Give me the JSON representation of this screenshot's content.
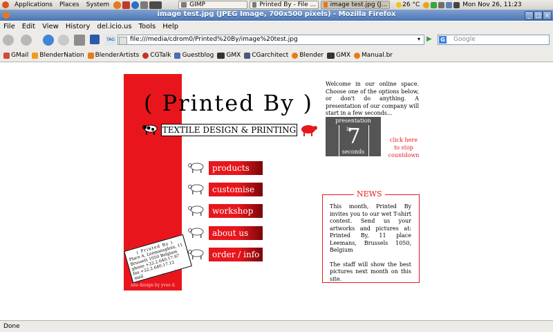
{
  "colors": {
    "accent_red": "#e8161c",
    "panel_bg": "#d7d3cc",
    "titlebar": "#4a75b5",
    "counter_bg": "#555555"
  },
  "panel": {
    "menus": [
      "Applications",
      "Places",
      "System"
    ],
    "tasks": [
      "GIMP",
      "Printed By - File ...",
      "image test.jpg (J..."
    ],
    "weather": "26 °C",
    "clock": "Mon Nov 26, 11:23"
  },
  "window": {
    "title": "image test.jpg (JPEG Image, 700x500 pixels) - Mozilla Firefox"
  },
  "menubar": [
    "File",
    "Edit",
    "View",
    "History",
    "del.icio.us",
    "Tools",
    "Help"
  ],
  "navbar": {
    "url": "file:///media/cdrom0/Printed%20By/image%20test.jpg",
    "search_placeholder": "Google"
  },
  "bookmarks": [
    "GMail",
    "BlenderNation",
    "BlenderArtists",
    "CGTalk",
    "Guestblog",
    "GMX",
    "CGarchitect",
    "Blender",
    "GMX",
    "Manual.br"
  ],
  "page": {
    "brand": "( Printed By )",
    "tagline": "TEXTILE DESIGN & PRINTING",
    "nav": [
      "products",
      "customise",
      "workshop",
      "about us",
      "order / info"
    ],
    "welcome": "Welcome in our online space. Choose one of the options below, or don't do anything. A presentation of our company will start in a few seconds...",
    "counter": {
      "label_top": "presentation",
      "label_in": "in",
      "number": "7",
      "label_bottom": "seconds"
    },
    "click_here": "click here to stop countdown",
    "news": {
      "title": "NEWS",
      "p1": "This month, Printed By invites you to our wet T-shirt contest. Send us your artworks and pictures at: Printed By, 11 place Leemans, Brussels 1050, Belgium",
      "p2": "The staff will show the best pictures next month on this site."
    },
    "card": {
      "line1": "( Printed By )",
      "line2": "Place A. Leemansplein, 11",
      "line3": "Brussels 1050 Belgium",
      "line4": "phone +32.2.640.17.87",
      "line5": "fax +32.2.640.17.12",
      "line6": "mail printed.by@skynet.be"
    },
    "credit": "site design by yves d."
  },
  "status": "Done"
}
